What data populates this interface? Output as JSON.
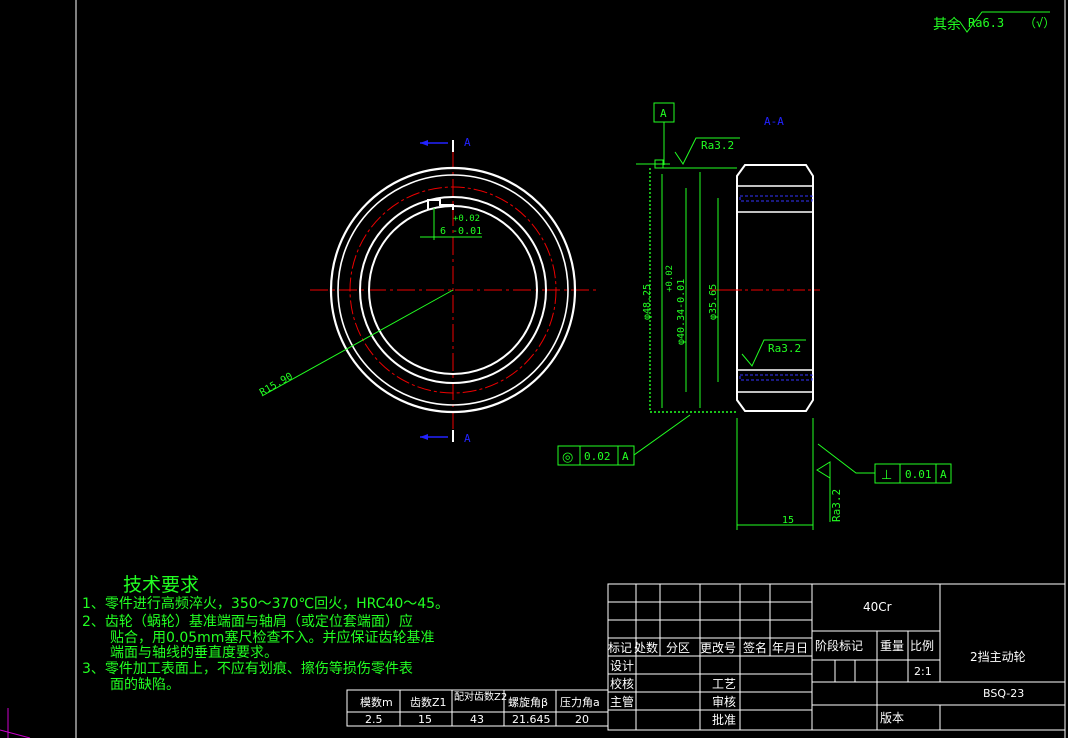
{
  "roughness": {
    "label": "其余",
    "value": "Ra6.3",
    "mark": "（√）"
  },
  "section": {
    "cut_label_top": "A",
    "cut_label_bottom": "A",
    "section_title": "A-A",
    "datum_letter": "A"
  },
  "front_view": {
    "radius_label": "R15.90",
    "keyway_tol_upper": "+0.02",
    "keyway_tol_lower": "6 -0.01"
  },
  "section_view": {
    "dia_outer": "φ48.25",
    "dia_bore_tol_upper": "+0.02",
    "dia_bore": "φ40.34-0.01",
    "dia_inner": "φ35.65",
    "ra_top": "Ra3.2",
    "ra_mid": "Ra3.2",
    "ra_right": "Ra3.2",
    "width_dim": "15"
  },
  "tolerances": {
    "concentricity": {
      "symbol": "◎",
      "value": "0.02",
      "datum": "A"
    },
    "perpendicularity": {
      "symbol": "⊥",
      "value": "0.01",
      "datum": "A"
    }
  },
  "tech_requirements": {
    "title": "技术要求",
    "lines": [
      "1、零件进行高频淬火，350～370℃回火，HRC40～45。",
      "2、齿轮（蜗轮）基准端面与轴肩（或定位套端面）应",
      "贴合，用0.05mm塞尺检查不入。并应保证齿轮基准",
      "端面与轴线的垂直度要求。",
      "3、零件加工表面上，不应有划痕、擦伤等损伤零件表",
      "面的缺陷。"
    ]
  },
  "gear_params": {
    "headers": [
      "模数m",
      "齿数Z1",
      "配对齿数Z2",
      "螺旋角β",
      "压力角a"
    ],
    "values": [
      "2.5",
      "15",
      "43",
      "21.645",
      "20"
    ]
  },
  "title_block": {
    "material": "40Cr",
    "part_name": "2挡主动轮",
    "drawing_no": "BSQ-23",
    "scale": "2:1",
    "version_label": "版本",
    "change_headers": [
      "标记",
      "处数",
      "分区",
      "更改号",
      "签名",
      "年月日"
    ],
    "stage_headers": [
      "阶段标记",
      "重量",
      "比例"
    ],
    "roles_left": [
      "设计",
      "校核",
      "主管"
    ],
    "roles_right": [
      "工艺",
      "审核",
      "批准"
    ]
  }
}
